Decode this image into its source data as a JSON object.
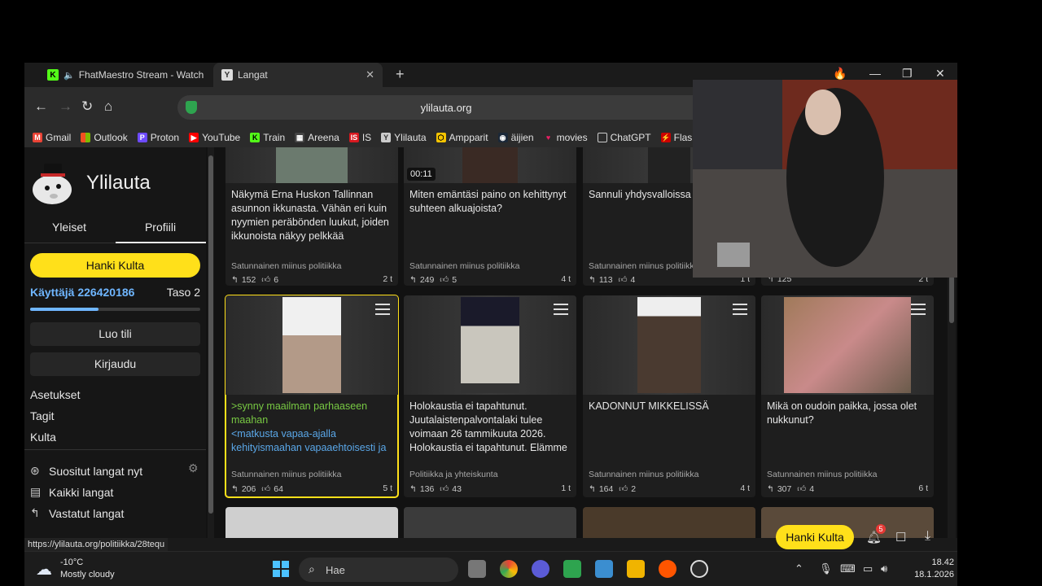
{
  "tabs": [
    {
      "title": "FhatMaestro Stream - Watch Li",
      "active": false
    },
    {
      "title": "Langat",
      "active": true
    }
  ],
  "url": "ylilauta.org",
  "bookmarks": [
    "Gmail",
    "Outlook",
    "Proton",
    "YouTube",
    "Train",
    "Areena",
    "IS",
    "Ylilauta",
    "Ampparit",
    "äijien",
    "movies",
    "ChatGPT",
    "Flashsc"
  ],
  "site": {
    "name": "Ylilauta",
    "tabs": [
      "Yleiset",
      "Profiili"
    ],
    "gold_button": "Hanki Kulta",
    "user": "Käyttäjä 226420186",
    "level": "Taso 2",
    "progress": 0.4,
    "create_account": "Luo tili",
    "login": "Kirjaudu",
    "links": [
      "Asetukset",
      "Tagit",
      "Kulta"
    ],
    "nav": [
      "Suositut langat nyt",
      "Kaikki langat",
      "Vastatut langat"
    ]
  },
  "video_duration": "00:11",
  "top_row": [
    {
      "title": "Näkymä Erna Huskon Tallinnan asunnon ikkunasta. Vähän eri kuin nyymien peräbönden luukut, joiden ikkunoista näkyy pelkkää",
      "category": "Satunnainen miinus politiikka",
      "replies": "152",
      "likes": "6",
      "age": "2 t"
    },
    {
      "title": "Miten emäntäsi paino on kehittynyt suhteen alkuajoista?",
      "category": "Satunnainen miinus politiikka",
      "replies": "249",
      "likes": "5",
      "age": "4 t"
    },
    {
      "title": "Sannuli yhdysvalloissa",
      "category": "Satunnainen miinus politiikka",
      "replies": "113",
      "likes": "4",
      "age": "1 t"
    },
    {
      "title": "",
      "category": "",
      "replies": "125",
      "likes": "",
      "age": "2 t"
    }
  ],
  "mid_row": [
    {
      "title_green": ">synny maailman parhaaseen maahan",
      "title_blue": "<matkusta vapaa-ajalla kehityismaahan vapaaehtoisesti ja",
      "category": "Satunnainen miinus politiikka",
      "replies": "206",
      "likes": "64",
      "age": "5 t"
    },
    {
      "title": "Holokaustia ei tapahtunut. Juutalaistenpalvontalaki tulee voimaan 26 tammikuuta 2026. Holokaustia ei tapahtunut. Elämme",
      "category": "Politiikka ja yhteiskunta",
      "replies": "136",
      "likes": "43",
      "age": "1 t"
    },
    {
      "title": "KADONNUT MIKKELISSÄ",
      "category": "Satunnainen miinus politiikka",
      "replies": "164",
      "likes": "2",
      "age": "4 t"
    },
    {
      "title": "Mikä on oudoin paikka, jossa olet nukkunut?",
      "category": "Satunnainen miinus politiikka",
      "replies": "307",
      "likes": "4",
      "age": "6 t"
    }
  ],
  "status_url": "https://ylilauta.org/politiikka/28tequ",
  "floating": {
    "gold": "Hanki Kulta",
    "notifications": "5"
  },
  "taskbar": {
    "temp": "-10°C",
    "weather": "Mostly cloudy",
    "search": "Hae",
    "time": "18.42",
    "date": "18.1.2026"
  },
  "colors": {
    "accent": "#ffe01a",
    "user": "#6fb6ff",
    "greentext": "#78c943"
  }
}
